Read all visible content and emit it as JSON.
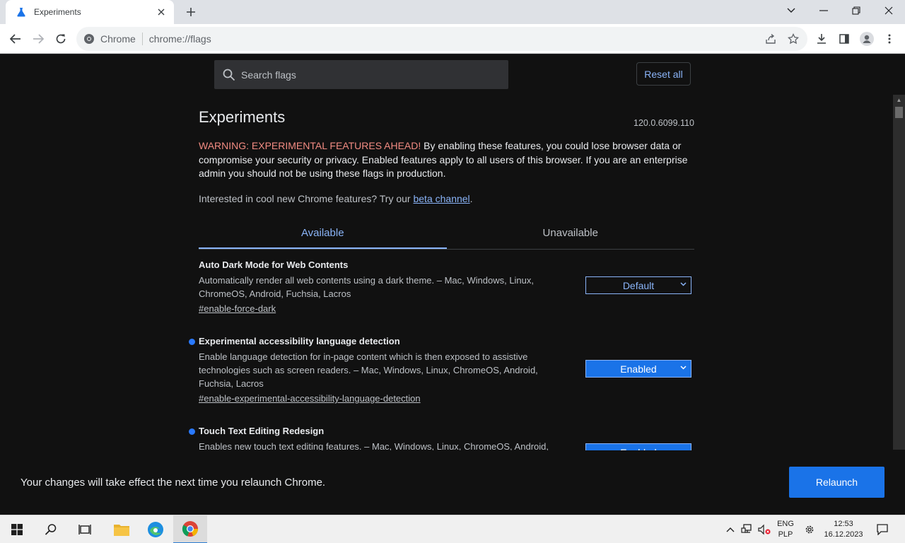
{
  "browser": {
    "tab_title": "Experiments",
    "omnibox_site": "Chrome",
    "omnibox_url": "chrome://flags"
  },
  "page": {
    "search_placeholder": "Search flags",
    "reset_label": "Reset all",
    "heading": "Experiments",
    "version": "120.0.6099.110",
    "warning_label": "WARNING: EXPERIMENTAL FEATURES AHEAD!",
    "warning_text": " By enabling these features, you could lose browser data or compromise your security or privacy. Enabled features apply to all users of this browser. If you are an enterprise admin you should not be using these flags in production.",
    "interest_text": "Interested in cool new Chrome features? Try our ",
    "beta_link": "beta channel",
    "interest_end": ".",
    "tabs": [
      {
        "label": "Available"
      },
      {
        "label": "Unavailable"
      }
    ],
    "flags": [
      {
        "name": "Auto Dark Mode for Web Contents",
        "desc": "Automatically render all web contents using a dark theme. – Mac, Windows, Linux, ChromeOS, Android, Fuchsia, Lacros",
        "link": "#enable-force-dark",
        "value": "Default"
      },
      {
        "name": "Experimental accessibility language detection",
        "desc": "Enable language detection for in-page content which is then exposed to assistive technologies such as screen readers. – Mac, Windows, Linux, ChromeOS, Android, Fuchsia, Lacros",
        "link": "#enable-experimental-accessibility-language-detection",
        "value": "Enabled"
      },
      {
        "name": "Touch Text Editing Redesign",
        "desc": "Enables new touch text editing features. – Mac, Windows, Linux, ChromeOS, Android,",
        "link": "",
        "value": "Enabled"
      }
    ],
    "relaunch_message": "Your changes will take effect the next time you relaunch Chrome.",
    "relaunch_button": "Relaunch"
  },
  "taskbar": {
    "lang_top": "ENG",
    "lang_bottom": "PLP",
    "time": "12:53",
    "date": "16.12.2023"
  }
}
